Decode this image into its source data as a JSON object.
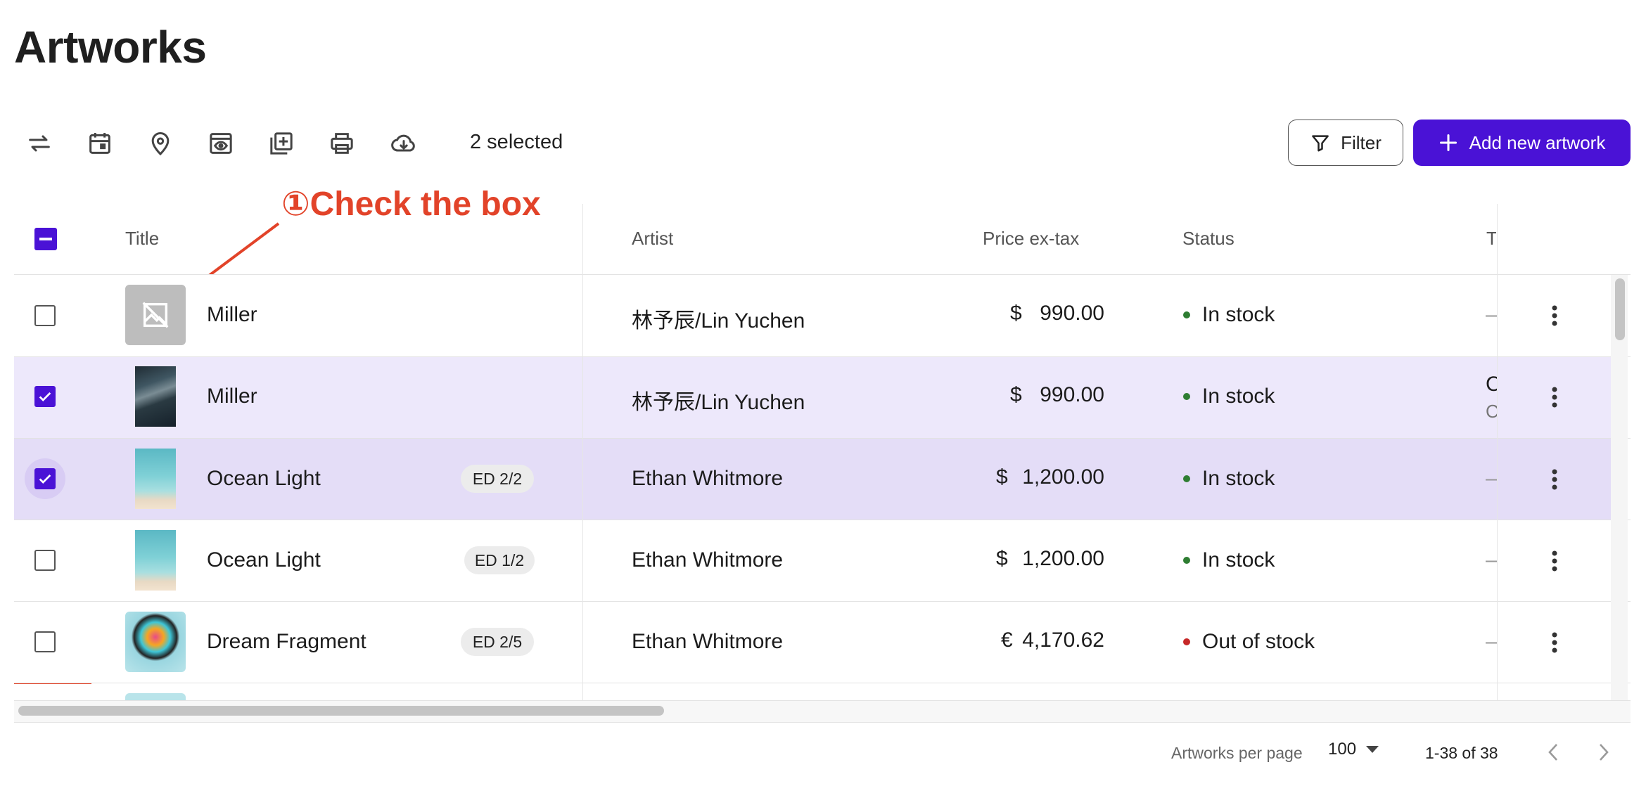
{
  "page": {
    "title": "Artworks"
  },
  "toolbar": {
    "icons": [
      {
        "name": "swap-arrows-icon"
      },
      {
        "name": "calendar-icon"
      },
      {
        "name": "location-pin-icon"
      },
      {
        "name": "preview-window-icon"
      },
      {
        "name": "add-to-collection-icon"
      },
      {
        "name": "printer-icon"
      },
      {
        "name": "cloud-download-icon"
      }
    ],
    "selected_text": "2 selected",
    "filter_label": "Filter",
    "add_label": "Add new artwork"
  },
  "annotation": {
    "text": "①Check the box",
    "color": "#e24329"
  },
  "table": {
    "headers": {
      "title": "Title",
      "artist": "Artist",
      "price": "Price ex-tax",
      "status": "Status",
      "truncated": "T"
    },
    "rows": [
      {
        "title": "Miller",
        "badge": "",
        "artist": "林予辰/Lin Yuchen",
        "currency": "$",
        "price": "990.00",
        "status": "In stock",
        "status_color": "#2e7d32",
        "extra": "–",
        "extra2": "",
        "checked": false,
        "thumb": "placeholder"
      },
      {
        "title": "Miller",
        "badge": "",
        "artist": "林予辰/Lin Yuchen",
        "currency": "$",
        "price": "990.00",
        "status": "In stock",
        "status_color": "#2e7d32",
        "extra": "C",
        "extra2": "C",
        "checked": true,
        "thumb": "cloudy-sky"
      },
      {
        "title": "Ocean Light",
        "badge": "ED 2/2",
        "artist": "Ethan Whitmore",
        "currency": "$",
        "price": "1,200.00",
        "status": "In stock",
        "status_color": "#2e7d32",
        "extra": "–",
        "extra2": "",
        "checked": true,
        "thumb": "ocean"
      },
      {
        "title": "Ocean Light",
        "badge": "ED 1/2",
        "artist": "Ethan Whitmore",
        "currency": "$",
        "price": "1,200.00",
        "status": "In stock",
        "status_color": "#2e7d32",
        "extra": "–",
        "extra2": "",
        "checked": false,
        "thumb": "ocean"
      },
      {
        "title": "Dream Fragment",
        "badge": "ED 2/5",
        "artist": "Ethan Whitmore",
        "currency": "€",
        "price": "4,170.62",
        "status": "Out of stock",
        "status_color": "#c62828",
        "extra": "–",
        "extra2": "",
        "checked": false,
        "thumb": "colorful-portrait"
      }
    ]
  },
  "footer": {
    "per_page_label": "Artworks per page",
    "per_page_value": "100",
    "range_text": "1-38 of 38"
  },
  "colors": {
    "accent": "#4a12d6",
    "selected_row": "#ede8fb",
    "selected_row_hover": "#e4ddf7",
    "annotation": "#e24329"
  }
}
